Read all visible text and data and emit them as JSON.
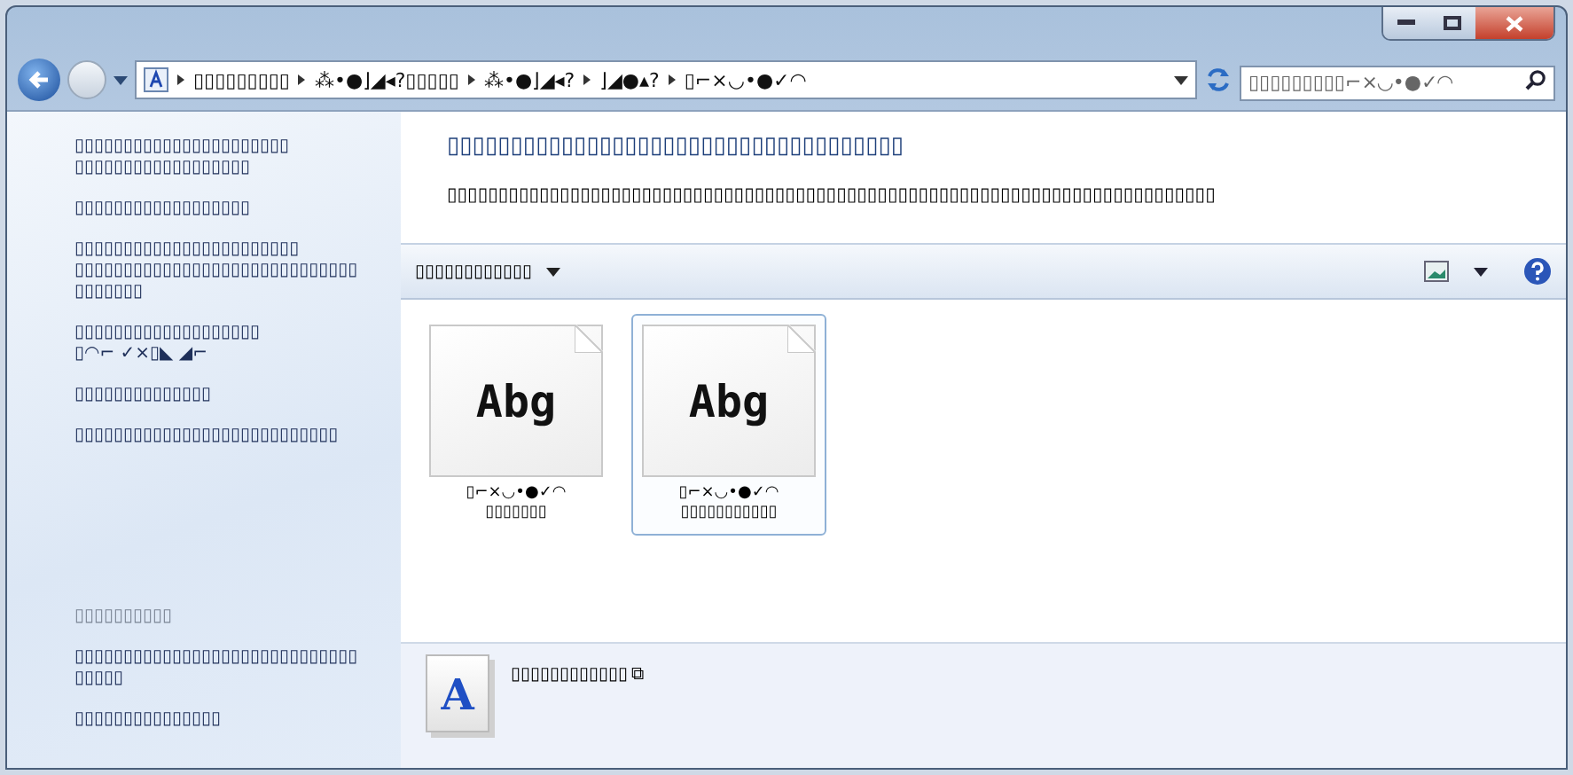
{
  "address_bar": {
    "crumbs": [
      "▯▯▯▯▯▯▯▯▯",
      "⁂•●⌋◢◂?▯▯▯▯▯",
      "⁂•●⌋◢◂?",
      "⌋◢●▴?",
      "▯⌐×◡•●✓◠"
    ]
  },
  "search": {
    "placeholder": "▯▯▯▯▯▯▯▯▯⌐×◡•●✓◠"
  },
  "sidebar": {
    "links": [
      {
        "lines": [
          "▯▯▯▯▯▯▯▯▯▯▯▯▯▯▯▯▯▯▯▯▯▯",
          "▯▯▯▯▯▯▯▯▯▯▯▯▯▯▯▯▯▯"
        ]
      },
      {
        "lines": [
          "▯▯▯▯▯▯▯▯▯▯▯▯▯▯▯▯▯▯"
        ]
      },
      {
        "lines": [
          "▯▯▯▯▯▯▯▯▯▯▯▯▯▯▯▯▯▯▯▯▯▯▯",
          "▯▯▯▯▯▯▯▯▯▯▯▯▯▯▯▯▯▯▯▯▯▯▯▯▯▯▯▯▯",
          "▯▯▯▯▯▯▯"
        ]
      },
      {
        "lines": [
          "▯▯▯▯▯▯▯▯▯▯▯▯▯▯▯▯▯▯▯",
          "▯◠⌐ ✓×▯◣ ◢⌐"
        ]
      },
      {
        "lines": [
          "▯▯▯▯▯▯▯▯▯▯▯▯▯▯"
        ]
      },
      {
        "lines": [
          "▯▯▯▯▯▯▯▯▯▯▯▯▯▯▯▯▯▯▯▯▯▯▯▯▯▯▯"
        ]
      }
    ],
    "see_also": {
      "heading": "▯▯▯▯▯▯▯▯▯▯",
      "links": [
        {
          "lines": [
            "▯▯▯▯▯▯▯▯▯▯▯▯▯▯▯▯▯▯▯▯▯▯▯▯▯▯▯▯▯",
            "▯▯▯▯▯"
          ]
        },
        {
          "lines": [
            "▯▯▯▯▯▯▯▯▯▯▯▯▯▯▯"
          ]
        }
      ]
    }
  },
  "header": {
    "title": "▯▯▯▯▯▯▯▯▯▯▯▯▯▯▯▯▯▯▯▯▯▯▯▯▯▯▯▯▯▯▯▯▯▯▯▯",
    "description": "▯▯▯▯▯▯▯▯▯▯▯▯▯▯▯▯▯▯▯▯▯▯▯▯▯▯▯▯▯▯▯▯▯▯▯▯▯▯▯▯▯▯▯▯▯▯▯▯▯▯▯▯▯▯▯▯▯▯▯▯▯▯▯▯▯▯▯▯▯▯▯▯▯▯▯"
  },
  "toolbar": {
    "organize": "▯▯▯▯▯▯▯▯▯▯▯▯"
  },
  "items": [
    {
      "preview": "Abg",
      "name": "▯⌐×◡•●✓◠",
      "subtitle": "▯▯▯▯▯▯▯",
      "selected": false
    },
    {
      "preview": "Abg",
      "name": "▯⌐×◡•●✓◠",
      "subtitle": "▯▯▯▯▯▯▯▯▯▯▯",
      "selected": true
    }
  ],
  "details": {
    "icon_letter": "A",
    "text": "▯▯▯▯▯▯▯▯▯▯▯▯",
    "link_glyph": "⧉"
  }
}
